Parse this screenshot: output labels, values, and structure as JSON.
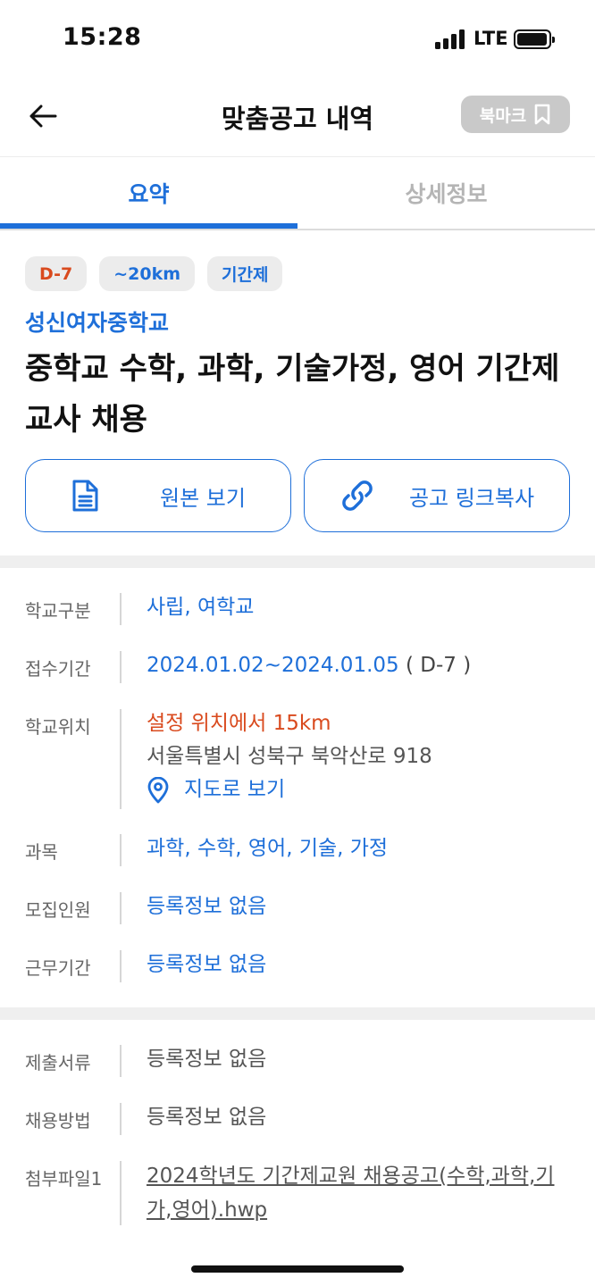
{
  "status_bar": {
    "time": "15:28",
    "network": "LTE"
  },
  "header": {
    "title": "맞춤공고 내역",
    "bookmark_label": "북마크"
  },
  "tabs": [
    {
      "label": "요약",
      "active": true
    },
    {
      "label": "상세정보",
      "active": false
    }
  ],
  "badges": [
    {
      "label": "D-7",
      "color": "#d94a1e"
    },
    {
      "label": "~20km",
      "color": "#1e6fd9"
    },
    {
      "label": "기간제",
      "color": "#1e6fd9"
    }
  ],
  "school_name": "성신여자중학교",
  "job_title": "중학교 수학, 과학, 기술가정, 영어 기간제 교사 채용",
  "actions": {
    "original_label": "원본 보기",
    "copy_label": "공고 링크복사"
  },
  "info": {
    "school_type": {
      "label": "학교구분",
      "value": "사립, 여학교"
    },
    "application_period": {
      "label": "접수기간",
      "value": "2024.01.02~2024.01.05",
      "dday": "( D-7 )"
    },
    "location": {
      "label": "학교위치",
      "distance": "설정 위치에서 15km",
      "address": "서울특별시 성북구 북악산로 918",
      "map_label": "지도로 보기"
    },
    "subjects": {
      "label": "과목",
      "value": "과학, 수학, 영어, 기술, 가정"
    },
    "recruits": {
      "label": "모집인원",
      "value": "등록정보 없음"
    },
    "work_period": {
      "label": "근무기간",
      "value": "등록정보 없음"
    }
  },
  "extra": {
    "documents": {
      "label": "제출서류",
      "value": "등록정보 없음"
    },
    "method": {
      "label": "채용방법",
      "value": "등록정보 없음"
    },
    "attachment": {
      "label": "첨부파일1",
      "value": "2024학년도 기간제교원 채용공고(수학,과학,기가,영어).hwp"
    }
  },
  "colors": {
    "accent": "#1e6fd9",
    "warning": "#d94a1e",
    "bookmark_bg": "#c9c9c9"
  },
  "icons": [
    "back-arrow-icon",
    "bookmark-icon",
    "document-icon",
    "link-icon",
    "location-pin-icon"
  ]
}
